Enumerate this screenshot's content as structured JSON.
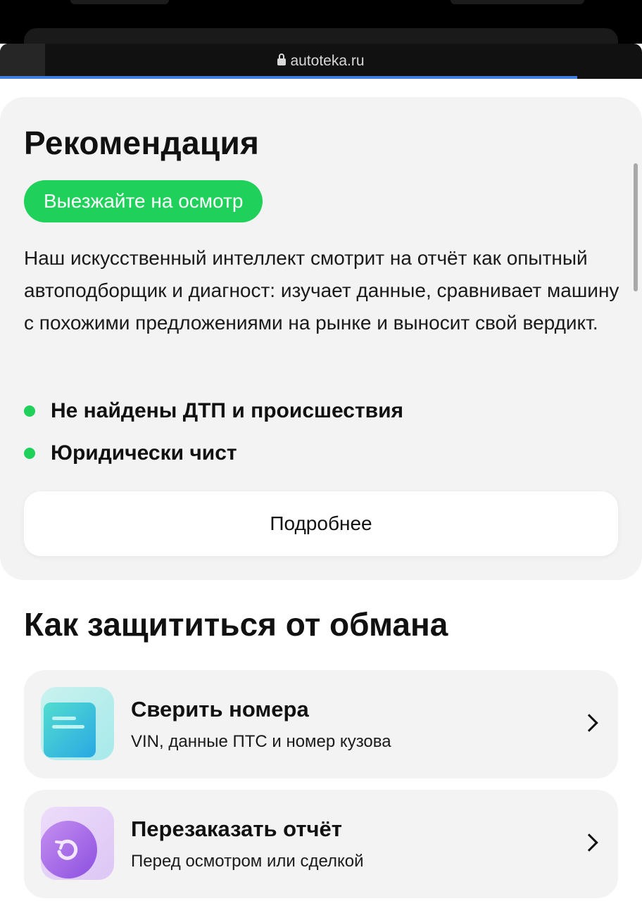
{
  "browser": {
    "url": "autoteka.ru"
  },
  "recommendation": {
    "title": "Рекомендация",
    "badge": "Выезжайте на осмотр",
    "description": "Наш искусственный интеллект смотрит на отчёт как опытный автоподборщик и диагност: изучает данные, сравнивает машину с похожими предложениями на рынке и выносит свой вердикт.",
    "checks": [
      {
        "label": "Не найдены ДТП и происшествия"
      },
      {
        "label": "Юридически чист"
      }
    ],
    "more_label": "Подробнее"
  },
  "protection": {
    "title": "Как защититься от обмана",
    "items": [
      {
        "title": "Сверить номера",
        "subtitle": "VIN, данные ПТС и номер кузова",
        "icon": "document-icon"
      },
      {
        "title": "Перезаказать отчёт",
        "subtitle": "Перед осмотром или сделкой",
        "icon": "refresh-icon"
      }
    ]
  },
  "colors": {
    "accent_green": "#1fd15a",
    "progress_blue": "#3f7fe0"
  }
}
